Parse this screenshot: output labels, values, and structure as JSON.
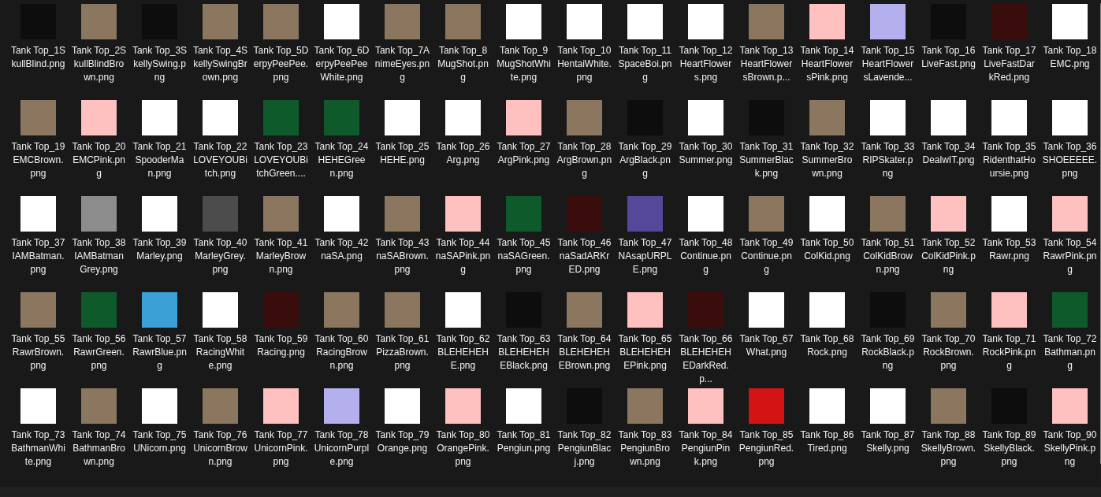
{
  "files": [
    {
      "name": "Tank Top_1SkullBlind.png",
      "color": "#0d0d0d"
    },
    {
      "name": "Tank Top_2SkullBlindBrown.png",
      "color": "#8b7660"
    },
    {
      "name": "Tank Top_3SkellySwing.png",
      "color": "#0d0d0d"
    },
    {
      "name": "Tank Top_4SkellySwingBrown.png",
      "color": "#8b7660"
    },
    {
      "name": "Tank Top_5DerpyPeePee.png",
      "color": "#8b7660"
    },
    {
      "name": "Tank Top_6DerpyPeePeeWhite.png",
      "color": "#ffffff"
    },
    {
      "name": "Tank Top_7AnimeEyes.png",
      "color": "#8b7660"
    },
    {
      "name": "Tank Top_8MugShot.png",
      "color": "#8b7660"
    },
    {
      "name": "Tank Top_9MugShotWhite.png",
      "color": "#ffffff"
    },
    {
      "name": "Tank Top_10HentaiWhite.png",
      "color": "#ffffff"
    },
    {
      "name": "Tank Top_11SpaceBoi.png",
      "color": "#ffffff"
    },
    {
      "name": "Tank Top_12HeartFlowers.png",
      "color": "#ffffff"
    },
    {
      "name": "Tank Top_13HeartFlowersBrown.p...",
      "color": "#8b7660"
    },
    {
      "name": "Tank Top_14HeartFlowersPink.png",
      "color": "#ffc0c0"
    },
    {
      "name": "Tank Top_15HeartFlowersLavende...",
      "color": "#b4b0ee"
    },
    {
      "name": "Tank Top_16LiveFast.png",
      "color": "#0d0d0d"
    },
    {
      "name": "Tank Top_17LiveFastDarkRed.png",
      "color": "#3a0d0d"
    },
    {
      "name": "Tank Top_18EMC.png",
      "color": "#ffffff"
    },
    {
      "name": "Tank Top_19EMCBrown.png",
      "color": "#8b7660"
    },
    {
      "name": "Tank Top_20EMCPink.png",
      "color": "#ffc0c0"
    },
    {
      "name": "Tank Top_21SpooderMan.png",
      "color": "#ffffff"
    },
    {
      "name": "Tank Top_22LOVEYOUBitch.png",
      "color": "#ffffff"
    },
    {
      "name": "Tank Top_23LOVEYOUBitchGreen....",
      "color": "#0e5a2a"
    },
    {
      "name": "Tank Top_24HEHEGreen.png",
      "color": "#0e5a2a"
    },
    {
      "name": "Tank Top_25HEHE.png",
      "color": "#ffffff"
    },
    {
      "name": "Tank Top_26Arg.png",
      "color": "#ffffff"
    },
    {
      "name": "Tank Top_27ArgPink.png",
      "color": "#ffc0c0"
    },
    {
      "name": "Tank Top_28ArgBrown.png",
      "color": "#8b7660"
    },
    {
      "name": "Tank Top_29ArgBlack.png",
      "color": "#0d0d0d"
    },
    {
      "name": "Tank Top_30Summer.png",
      "color": "#ffffff"
    },
    {
      "name": "Tank Top_31SummerBlack.png",
      "color": "#0d0d0d"
    },
    {
      "name": "Tank Top_32SummerBrown.png",
      "color": "#8b7660"
    },
    {
      "name": "Tank Top_33RIPSkater.png",
      "color": "#ffffff"
    },
    {
      "name": "Tank Top_34DealwIT.png",
      "color": "#ffffff"
    },
    {
      "name": "Tank Top_35RidenthatHoursie.png",
      "color": "#ffffff"
    },
    {
      "name": "Tank Top_36SHOEEEEE.png",
      "color": "#ffffff"
    },
    {
      "name": "Tank Top_37IAMBatman.png",
      "color": "#ffffff"
    },
    {
      "name": "Tank Top_38IAMBatmanGrey.png",
      "color": "#8c8c8c"
    },
    {
      "name": "Tank Top_39Marley.png",
      "color": "#ffffff"
    },
    {
      "name": "Tank Top_40MarleyGrey.png",
      "color": "#4c4c4c"
    },
    {
      "name": "Tank Top_41MarleyBrown.png",
      "color": "#8b7660"
    },
    {
      "name": "Tank Top_42naSA.png",
      "color": "#ffffff"
    },
    {
      "name": "Tank Top_43naSABrown.png",
      "color": "#8b7660"
    },
    {
      "name": "Tank Top_44naSAPink.png",
      "color": "#ffc0c0"
    },
    {
      "name": "Tank Top_45naSAGreen.png",
      "color": "#0e5a2a"
    },
    {
      "name": "Tank Top_46naSadARKrED.png",
      "color": "#3a0d0d"
    },
    {
      "name": "Tank Top_47NAsapURPLE.png",
      "color": "#55489a"
    },
    {
      "name": "Tank Top_48Continue.png",
      "color": "#ffffff"
    },
    {
      "name": "Tank Top_49Continue.png",
      "color": "#8b7660"
    },
    {
      "name": "Tank Top_50ColKid.png",
      "color": "#ffffff"
    },
    {
      "name": "Tank Top_51ColKidBrown.png",
      "color": "#8b7660"
    },
    {
      "name": "Tank Top_52ColKidPink.png",
      "color": "#ffc0c0"
    },
    {
      "name": "Tank Top_53Rawr.png",
      "color": "#ffffff"
    },
    {
      "name": "Tank Top_54RawrPink.png",
      "color": "#ffc0c0"
    },
    {
      "name": "Tank Top_55RawrBrown.png",
      "color": "#8b7660"
    },
    {
      "name": "Tank Top_56RawrGreen.png",
      "color": "#0e5a2a"
    },
    {
      "name": "Tank Top_57RawrBlue.png",
      "color": "#3aa0d6"
    },
    {
      "name": "Tank Top_58RacingWhite.png",
      "color": "#ffffff"
    },
    {
      "name": "Tank Top_59Racing.png",
      "color": "#3a0d0d"
    },
    {
      "name": "Tank Top_60RacingBrown.png",
      "color": "#8b7660"
    },
    {
      "name": "Tank Top_61PizzaBrown.png",
      "color": "#8b7660"
    },
    {
      "name": "Tank Top_62BLEHEHEHE.png",
      "color": "#ffffff"
    },
    {
      "name": "Tank Top_63BLEHEHEHEBlack.png",
      "color": "#0d0d0d"
    },
    {
      "name": "Tank Top_64BLEHEHEHEBrown.png",
      "color": "#8b7660"
    },
    {
      "name": "Tank Top_65BLEHEHEHEPink.png",
      "color": "#ffc0c0"
    },
    {
      "name": "Tank Top_66BLEHEHEHEDarkRed.p...",
      "color": "#3a0d0d"
    },
    {
      "name": "Tank Top_67What.png",
      "color": "#ffffff"
    },
    {
      "name": "Tank Top_68Rock.png",
      "color": "#ffffff"
    },
    {
      "name": "Tank Top_69RockBlack.png",
      "color": "#0d0d0d"
    },
    {
      "name": "Tank Top_70RockBrown.png",
      "color": "#8b7660"
    },
    {
      "name": "Tank Top_71RockPink.png",
      "color": "#ffc0c0"
    },
    {
      "name": "Tank Top_72Bathman.png",
      "color": "#0e5a2a"
    },
    {
      "name": "Tank Top_73BathmanWhite.png",
      "color": "#ffffff"
    },
    {
      "name": "Tank Top_74BathmanBrown.png",
      "color": "#8b7660"
    },
    {
      "name": "Tank Top_75UNicorn.png",
      "color": "#ffffff"
    },
    {
      "name": "Tank Top_76UnicornBrown.png",
      "color": "#8b7660"
    },
    {
      "name": "Tank Top_77UnicornPink.png",
      "color": "#ffc0c0"
    },
    {
      "name": "Tank Top_78UnicornPurple.png",
      "color": "#b4b0ee"
    },
    {
      "name": "Tank Top_79Orange.png",
      "color": "#ffffff"
    },
    {
      "name": "Tank Top_80OrangePink.png",
      "color": "#ffc0c0"
    },
    {
      "name": "Tank Top_81Pengiun.png",
      "color": "#ffffff"
    },
    {
      "name": "Tank Top_82PengiunBlacj.png",
      "color": "#0d0d0d"
    },
    {
      "name": "Tank Top_83PengiunBrown.png",
      "color": "#8b7660"
    },
    {
      "name": "Tank Top_84PengiunPink.png",
      "color": "#ffc0c0"
    },
    {
      "name": "Tank Top_85PengiunRed.png",
      "color": "#d41414"
    },
    {
      "name": "Tank Top_86Tired.png",
      "color": "#ffffff"
    },
    {
      "name": "Tank Top_87Skelly.png",
      "color": "#ffffff"
    },
    {
      "name": "Tank Top_88SkellyBrown.png",
      "color": "#8b7660"
    },
    {
      "name": "Tank Top_89SkellyBlack.png",
      "color": "#0d0d0d"
    },
    {
      "name": "Tank Top_90SkellyPink.png",
      "color": "#ffc0c0"
    }
  ]
}
